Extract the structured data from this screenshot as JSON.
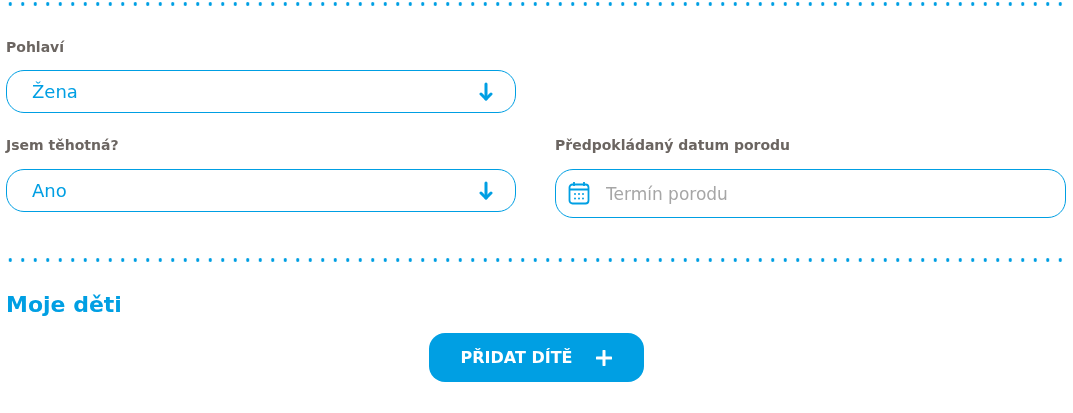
{
  "gender": {
    "label": "Pohlaví",
    "value": "Žena"
  },
  "pregnant": {
    "label": "Jsem těhotná?",
    "value": "Ano"
  },
  "due_date": {
    "label": "Předpokládaný datum porodu",
    "placeholder": "Termín porodu"
  },
  "children_section": {
    "title": "Moje děti",
    "add_button": "PŘIDAT DÍTĚ"
  }
}
